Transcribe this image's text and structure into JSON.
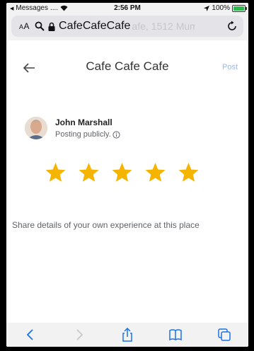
{
  "status_bar": {
    "back_app": "Messages",
    "signal": "....",
    "time": "2:56 PM",
    "battery": "100%"
  },
  "browser": {
    "aa_label": "AA",
    "url_text": "CafeCafeCafe",
    "url_faded": "afe, 1512 Mumc"
  },
  "header": {
    "title": "Cafe Cafe Cafe",
    "post_label": "Post"
  },
  "user": {
    "name": "John Marshall",
    "posting_status": "Posting publicly."
  },
  "rating": {
    "stars": 5,
    "star_color": "#F4B400"
  },
  "review": {
    "placeholder": "Share details of your own experience at this place"
  },
  "colors": {
    "accent": "#9FB7E8",
    "toolbar_icon": "#1a73e8"
  }
}
